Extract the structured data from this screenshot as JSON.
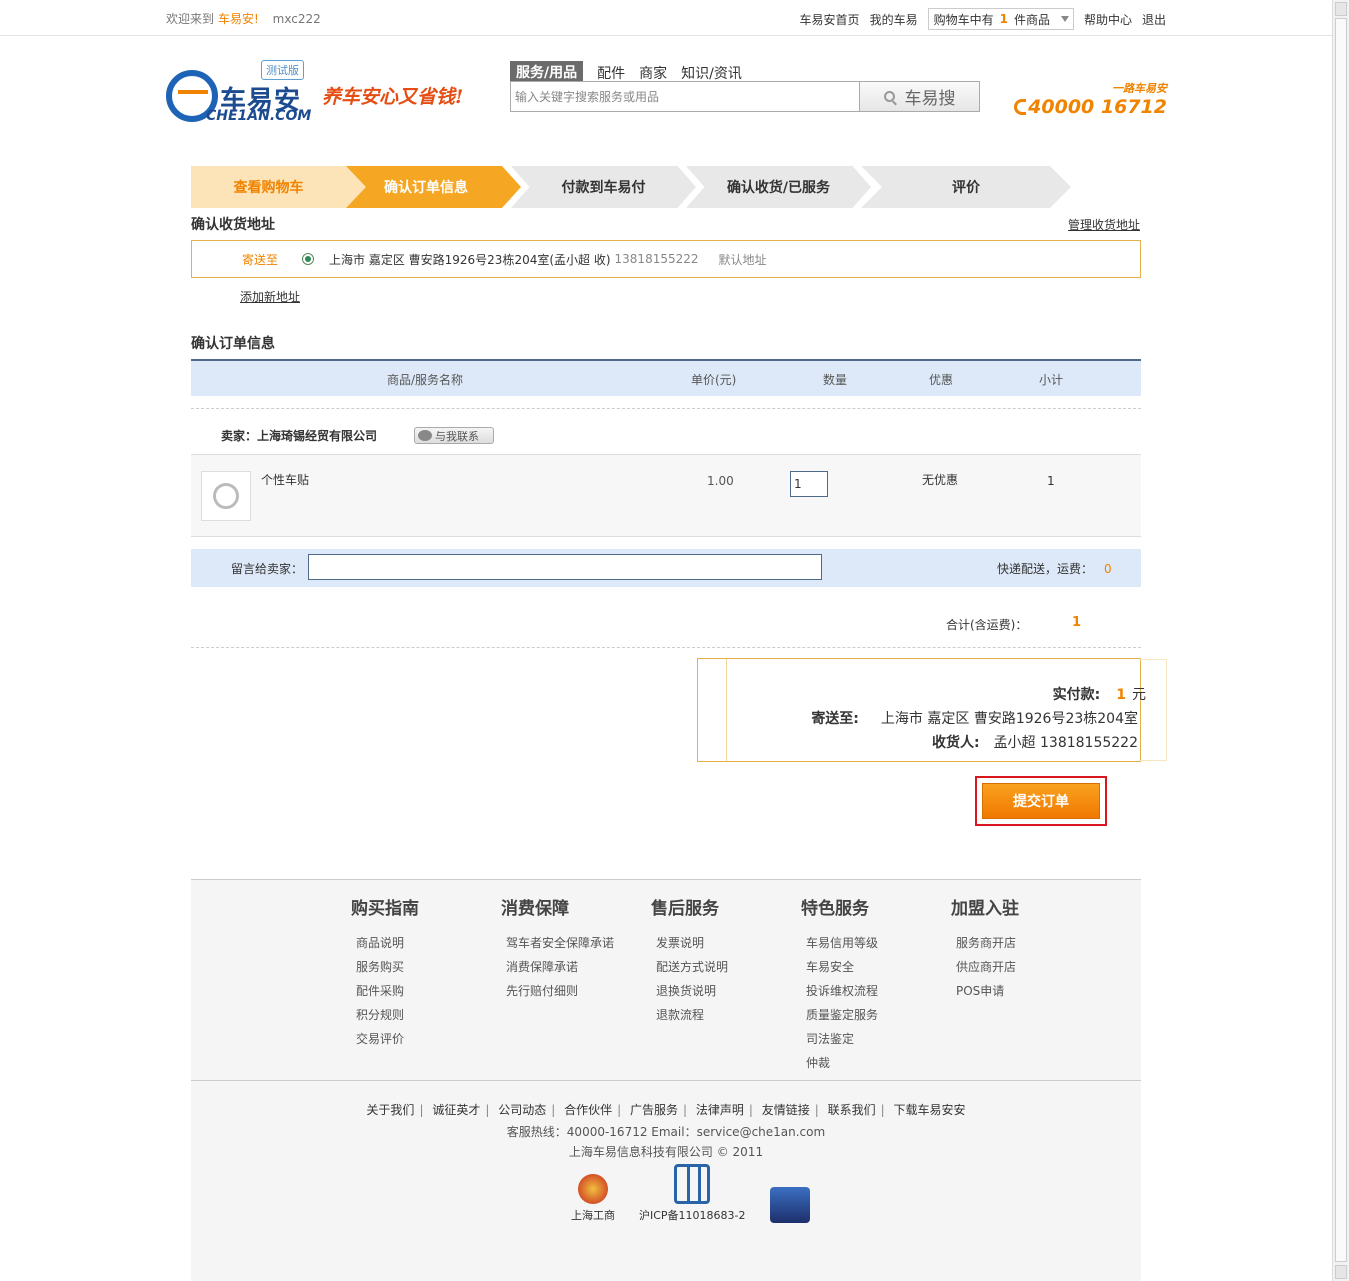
{
  "topbar": {
    "welcome": "欢迎来到",
    "brand": "车易安!",
    "username": "mxc222",
    "links": [
      "车易安首页",
      "我的车易"
    ],
    "cart_prefix": "购物车中有",
    "cart_count": "1",
    "cart_suffix": "件商品",
    "help": "帮助中心",
    "logout": "退出"
  },
  "header": {
    "logo_cn": "车易安",
    "logo_en": "CHE1AN.COM",
    "beta": "测试版",
    "slogan": "养车安心又省钱!",
    "search_tabs": [
      "服务/用品",
      "配件",
      "商家",
      "知识/资讯"
    ],
    "search_placeholder": "输入关键字搜索服务或用品",
    "search_button": "车易搜",
    "hotline_tag": "一路车易安",
    "hotline": "40000 16712"
  },
  "steps": [
    "查看购物车",
    "确认订单信息",
    "付款到车易付",
    "确认收货/已服务",
    "评价"
  ],
  "address": {
    "title": "确认收货地址",
    "manage": "管理收货地址",
    "send_to": "寄送至",
    "address_text": "上海市  嘉定区  曹安路1926号23栋204室(孟小超  收)",
    "phone": "13818155222",
    "default_label": "默认地址",
    "add_new": "添加新地址"
  },
  "order": {
    "title": "确认订单信息",
    "columns": [
      "商品/服务名称",
      "单价(元)",
      "数量",
      "优惠",
      "小计"
    ],
    "seller_label": "卖家：上海琦锡经贸有限公司",
    "contact_button": "与我联系",
    "items": [
      {
        "name": "个性车贴",
        "price": "1.00",
        "qty": "1",
        "discount": "无优惠",
        "subtotal": "1"
      }
    ],
    "message_label": "留言给卖家：",
    "shipping_label": "快递配送，运费：",
    "shipping_fee": "0",
    "total_label": "合计(含运费)：",
    "total": "1"
  },
  "summary": {
    "pay_label": "实付款:",
    "pay_amount": "1",
    "pay_unit": "元",
    "ship_label": "寄送至:",
    "ship_address": "上海市  嘉定区  曹安路1926号23栋204室",
    "receiver_label": "收货人:",
    "receiver": "孟小超  13818155222"
  },
  "submit_label": "提交订单",
  "footer": {
    "columns": [
      {
        "title": "购买指南",
        "items": [
          "商品说明",
          "服务购买",
          "配件采购",
          "积分规则",
          "交易评价"
        ]
      },
      {
        "title": "消费保障",
        "items": [
          "驾车者安全保障承诺",
          "消费保障承诺",
          "先行赔付细则"
        ]
      },
      {
        "title": "售后服务",
        "items": [
          "发票说明",
          "配送方式说明",
          "退换货说明",
          "退款流程"
        ]
      },
      {
        "title": "特色服务",
        "items": [
          "车易信用等级",
          "车易安全",
          "投诉维权流程",
          "质量鉴定服务",
          "司法鉴定",
          "仲裁"
        ]
      },
      {
        "title": "加盟入驻",
        "items": [
          "服务商开店",
          "供应商开店",
          "POS申请"
        ]
      }
    ],
    "links": [
      "关于我们",
      "诚征英才",
      "公司动态",
      "合作伙伴",
      "广告服务",
      "法律声明",
      "友情链接",
      "联系我们",
      "下载车易安安"
    ],
    "service_line": "客服热线：40000-16712 Email：service@che1an.com",
    "copyright": "上海车易信息科技有限公司 © 2011",
    "badge1": "上海工商",
    "badge2": "沪ICP备11018683-2"
  }
}
